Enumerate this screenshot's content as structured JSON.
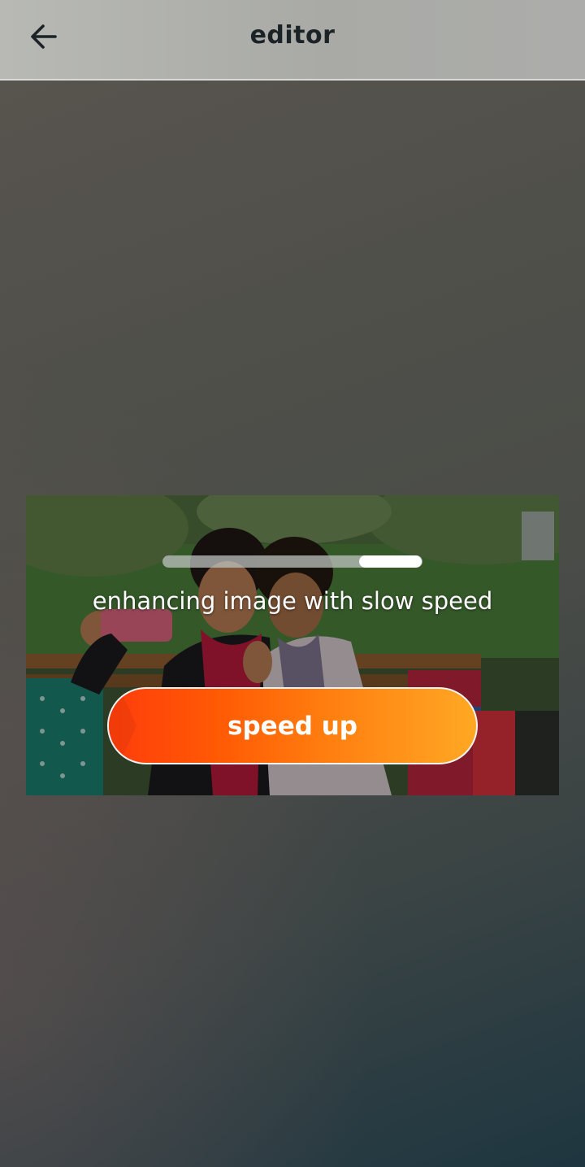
{
  "header": {
    "title": "editor",
    "back_icon": "arrow-left-icon"
  },
  "enhance": {
    "progress": 0.25,
    "status_text": "enhancing image with slow speed",
    "button_label": "speed up"
  },
  "colors": {
    "button_gradient_start": "#ff3d0c",
    "button_gradient_end": "#ffa824",
    "title_color": "#1c2327"
  }
}
